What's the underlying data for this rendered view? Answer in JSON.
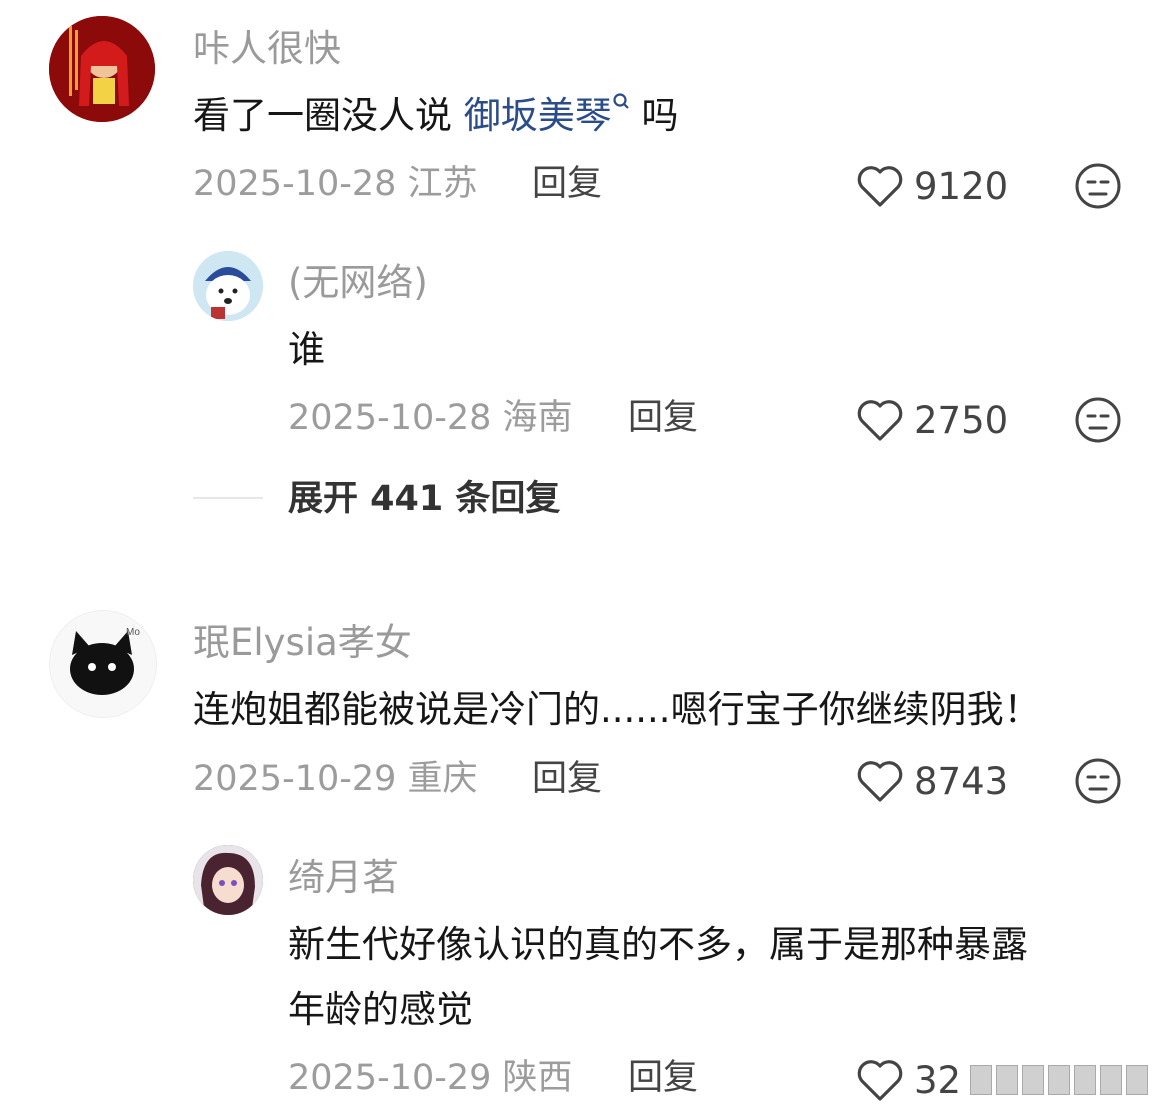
{
  "comments": [
    {
      "username": "咔人很快",
      "text_before": "看了一圈没人说 ",
      "link": "御坂美琴",
      "text_after": " 吗",
      "date": "2025-10-28",
      "location": "江苏",
      "reply_label": "回复",
      "likes": "9120",
      "replies": [
        {
          "username": "(无网络)",
          "text": "谁",
          "date": "2025-10-28",
          "location": "海南",
          "reply_label": "回复",
          "likes": "2750"
        }
      ],
      "expand_label": "展开 441 条回复"
    },
    {
      "username": "珉Elysia孝女",
      "text": "连炮姐都能被说是冷门的......嗯行宝子你继续阴我！",
      "date": "2025-10-29",
      "location": "重庆",
      "reply_label": "回复",
      "likes": "8743",
      "replies": [
        {
          "username": "绮月茗",
          "text_line1": "新生代好像认识的真的不多，属于是那种暴露",
          "text_line2": "年龄的感觉",
          "date": "2025-10-29",
          "location": "陕西",
          "reply_label": "回复",
          "likes": "32"
        }
      ]
    }
  ],
  "icons": {
    "like": "heart-outline-icon",
    "dislike": "unamused-face-icon",
    "search": "search-icon"
  },
  "colors": {
    "link": "#2a4c8a",
    "username": "#9a9a9a",
    "meta": "#9c9c9c"
  }
}
